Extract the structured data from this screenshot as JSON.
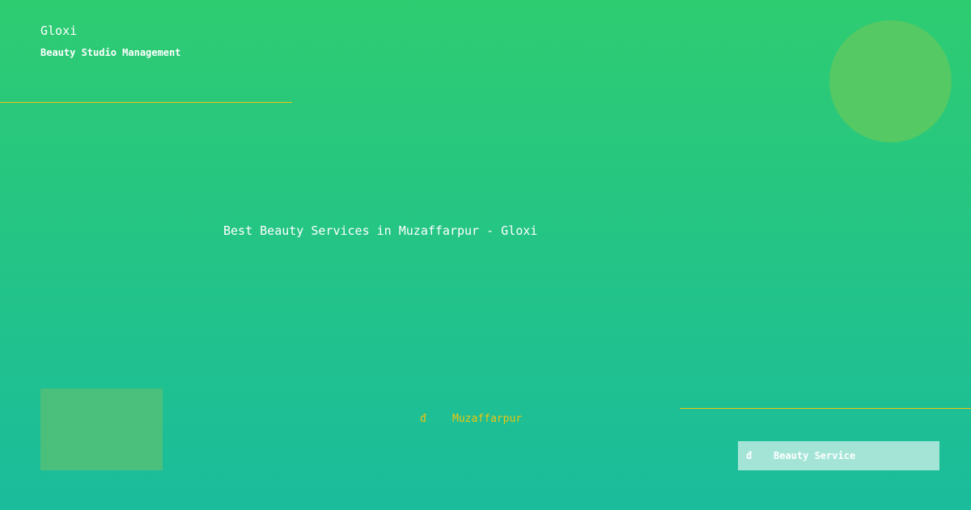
{
  "brand": {
    "name": "Gloxi",
    "tagline": "Beauty Studio Management"
  },
  "headline": "Best Beauty Services in Muzaffarpur - Gloxi",
  "location": {
    "icon_glyph": "đ",
    "icon_name": "location-pin-icon",
    "text": "Muzaffarpur"
  },
  "service_badge": {
    "icon_glyph": "đ",
    "icon_name": "beauty-icon",
    "label": "Beauty Service"
  },
  "colors": {
    "gradient_top": "#2ecc71",
    "gradient_bottom": "#1abc9c",
    "accent": "#f1c40f",
    "text": "#ffffff",
    "badge_bg": "#a3e4d7"
  }
}
